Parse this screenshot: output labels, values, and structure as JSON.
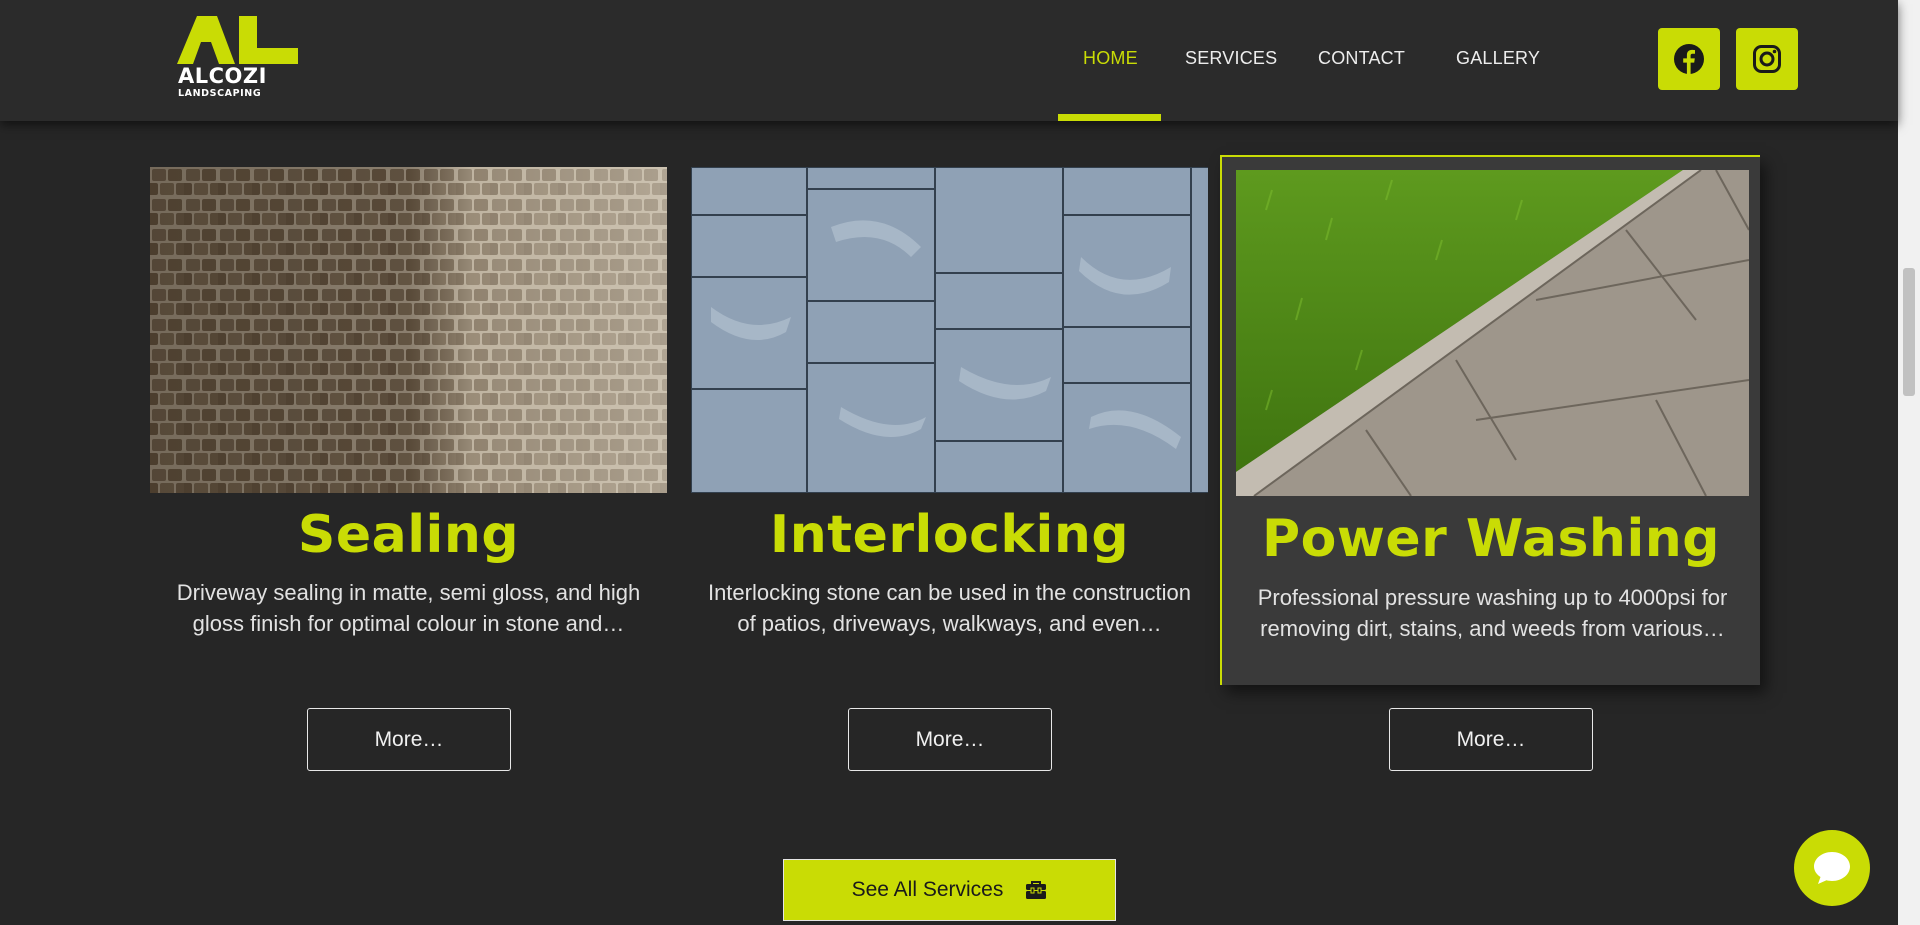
{
  "brand": {
    "name": "ALCOZI",
    "tagline": "LANDSCAPING",
    "accent_color": "#c9dc05",
    "logo_icon": "al-monogram-icon"
  },
  "nav": {
    "items": [
      {
        "label": "HOME",
        "active": true
      },
      {
        "label": "SERVICES",
        "active": false
      },
      {
        "label": "CONTACT",
        "active": false
      },
      {
        "label": "GALLERY",
        "active": false
      }
    ]
  },
  "social": [
    {
      "icon": "facebook-icon"
    },
    {
      "icon": "instagram-icon"
    }
  ],
  "services": [
    {
      "title": "Sealing",
      "description": "Driveway sealing in matte, semi gloss, and high gloss finish for optimal colour in stone and…",
      "button": "More…"
    },
    {
      "title": "Interlocking",
      "description": "Interlocking stone can be used in the construction of patios, driveways, walkways, and even…",
      "button": "More…"
    },
    {
      "title": "Power Washing",
      "description": "Professional pressure washing up to 4000psi for removing dirt, stains, and weeds from various…",
      "button": "More…"
    }
  ],
  "cta": {
    "label": "See All Services",
    "icon": "toolbox-icon"
  },
  "chat": {
    "icon": "chat-bubble-icon"
  }
}
